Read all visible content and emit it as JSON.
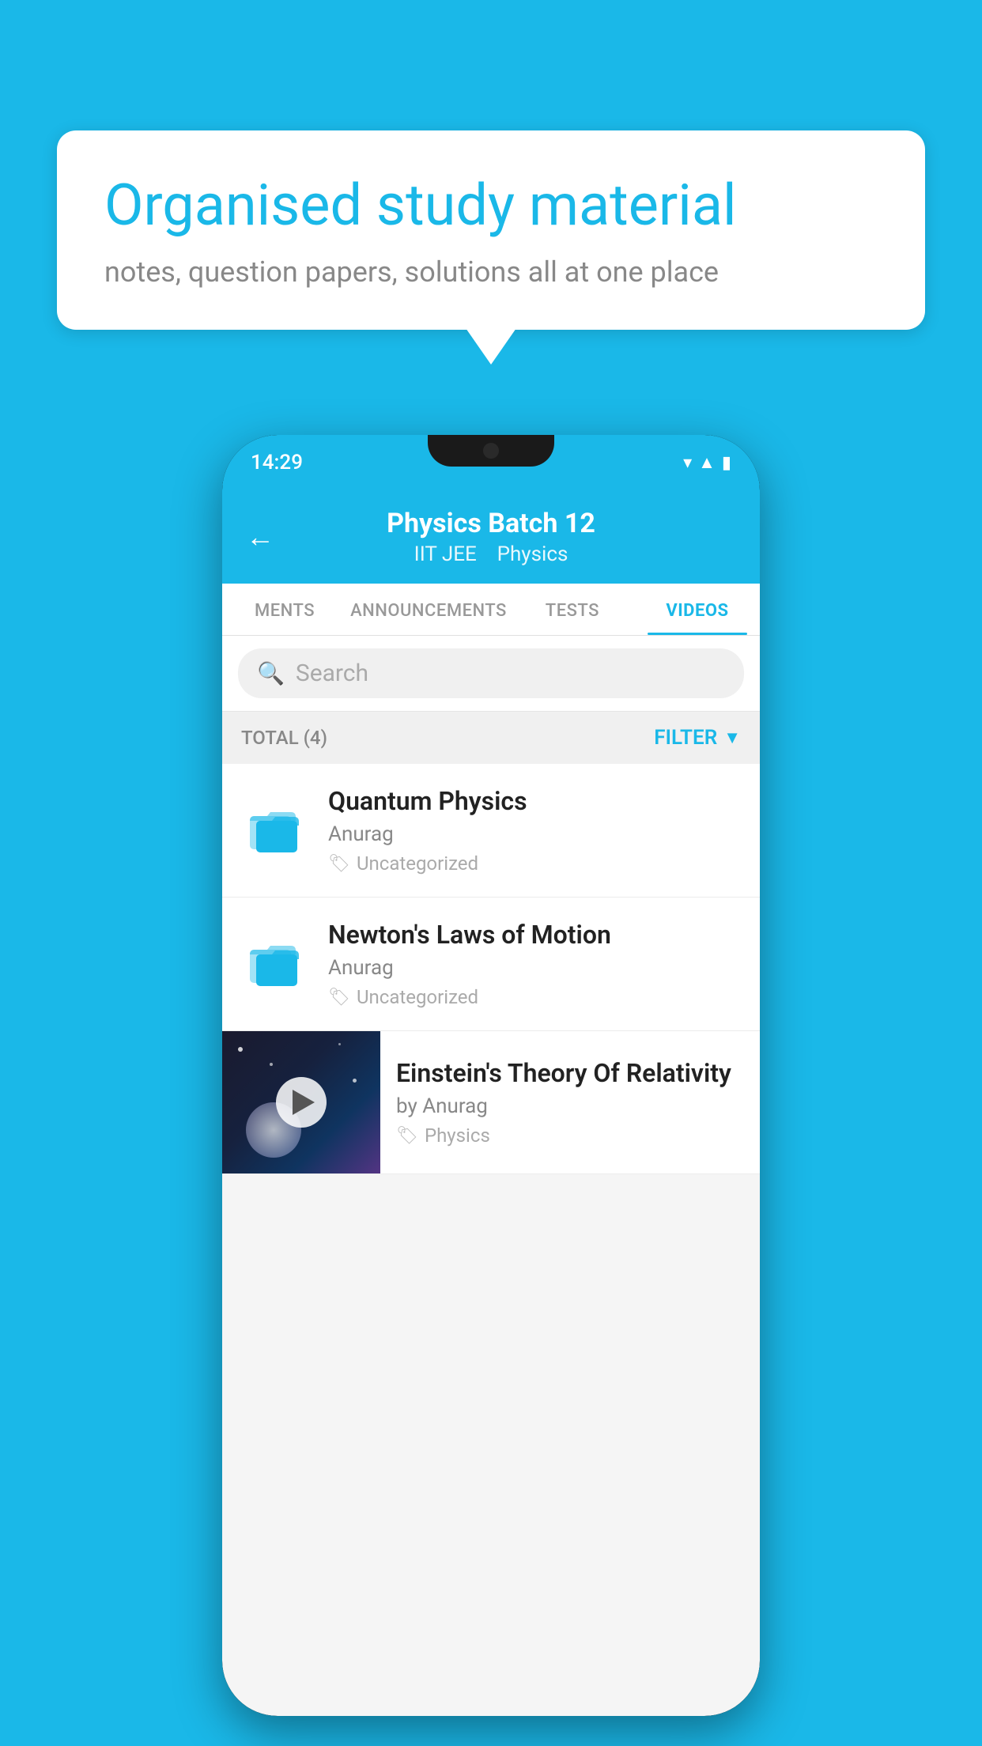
{
  "background_color": "#1ab8e8",
  "speech_bubble": {
    "title": "Organised study material",
    "subtitle": "notes, question papers, solutions all at one place"
  },
  "phone": {
    "status_bar": {
      "time": "14:29",
      "icons": [
        "wifi",
        "signal",
        "battery"
      ]
    },
    "header": {
      "back_label": "←",
      "title": "Physics Batch 12",
      "subtitle_parts": [
        "IIT JEE",
        "Physics"
      ]
    },
    "tabs": [
      {
        "label": "MENTS",
        "active": false
      },
      {
        "label": "ANNOUNCEMENTS",
        "active": false
      },
      {
        "label": "TESTS",
        "active": false
      },
      {
        "label": "VIDEOS",
        "active": true
      }
    ],
    "search": {
      "placeholder": "Search"
    },
    "filter_bar": {
      "total_label": "TOTAL (4)",
      "filter_label": "FILTER"
    },
    "videos": [
      {
        "title": "Quantum Physics",
        "author": "Anurag",
        "tag": "Uncategorized",
        "has_thumbnail": false
      },
      {
        "title": "Newton's Laws of Motion",
        "author": "Anurag",
        "tag": "Uncategorized",
        "has_thumbnail": false
      },
      {
        "title": "Einstein's Theory Of Relativity",
        "author": "by Anurag",
        "tag": "Physics",
        "has_thumbnail": true
      }
    ]
  }
}
